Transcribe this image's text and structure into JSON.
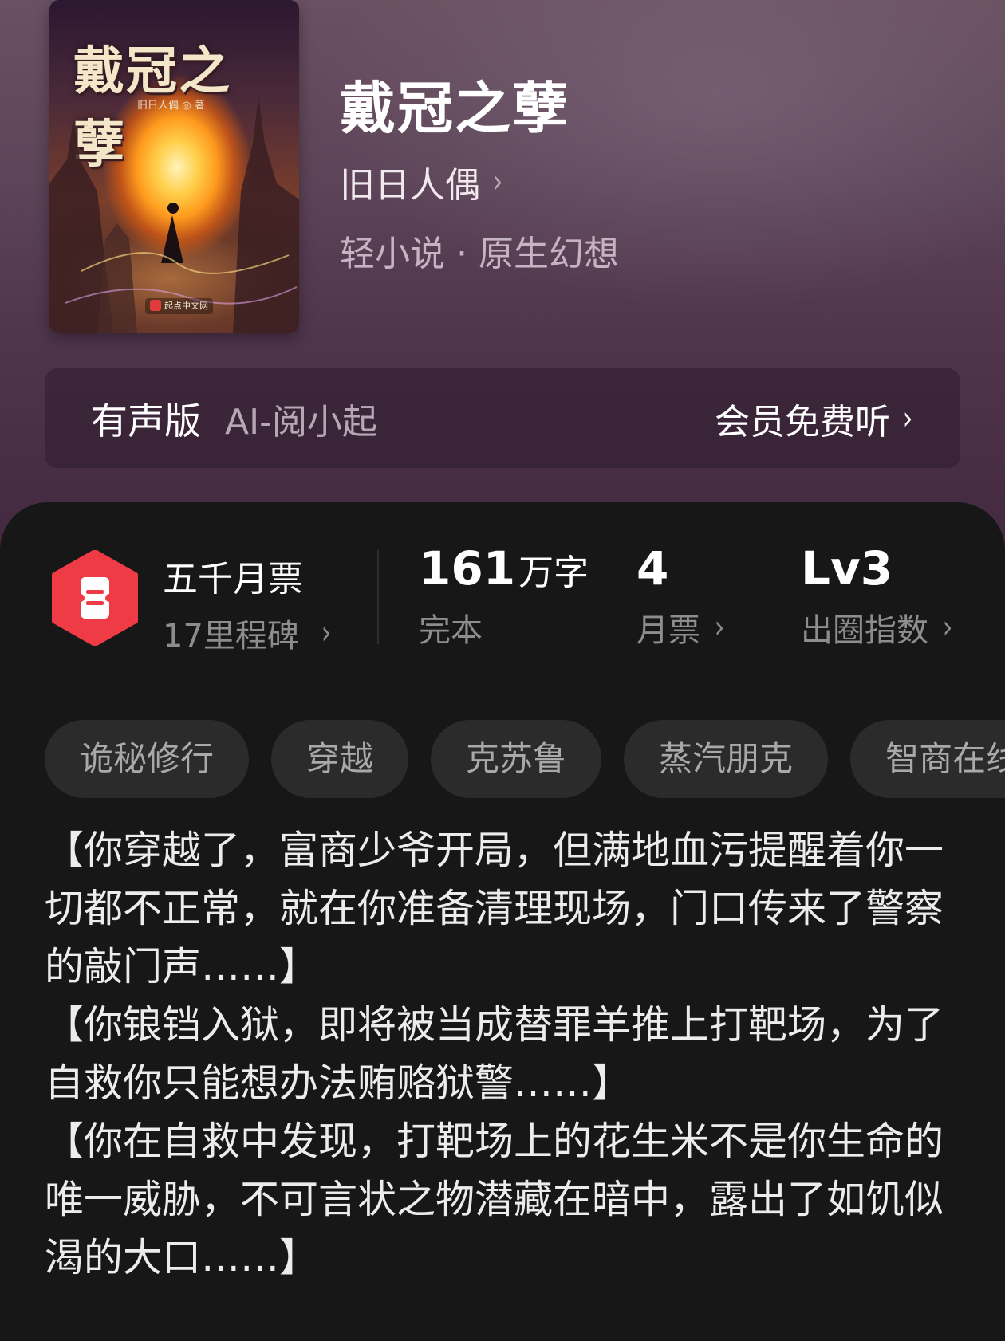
{
  "book": {
    "cover_title": "戴冠之孽",
    "cover_author": "旧日人偶 ◎ 著",
    "cover_publisher": "起点中文网",
    "title": "戴冠之孽",
    "author": "旧日人偶",
    "category": "轻小说 · 原生幻想"
  },
  "audio": {
    "label": "有声版",
    "sub": "AI-阅小起",
    "action": "会员免费听"
  },
  "stats": {
    "milestone_title": "五千月票",
    "milestone_sub": "17里程碑",
    "word_count": "161",
    "word_unit": "万字",
    "status": "完本",
    "monthly_votes": "4",
    "monthly_votes_label": "月票",
    "level": "Lv3",
    "level_label": "出圈指数"
  },
  "tags": [
    "诡秘修行",
    "穿越",
    "克苏鲁",
    "蒸汽朋克",
    "智商在线"
  ],
  "synopsis": [
    "【你穿越了，富商少爷开局，但满地血污提醒着你一切都不正常，就在你准备清理现场，门口传来了警察的敲门声……】",
    "【你锒铛入狱，即将被当成替罪羊推上打靶场，为了自救你只能想办法贿赂狱警……】",
    "【你在自救中发现，打靶场上的花生米不是你生命的唯一威胁，不可言状之物潜藏在暗中，露出了如饥似渴的大口……】"
  ],
  "colors": {
    "header_top": "#6a5162",
    "header_bottom": "#43293f",
    "background": "#171717",
    "badge_red": "#ee3b46",
    "tag_bg": "#2b2b2b"
  }
}
